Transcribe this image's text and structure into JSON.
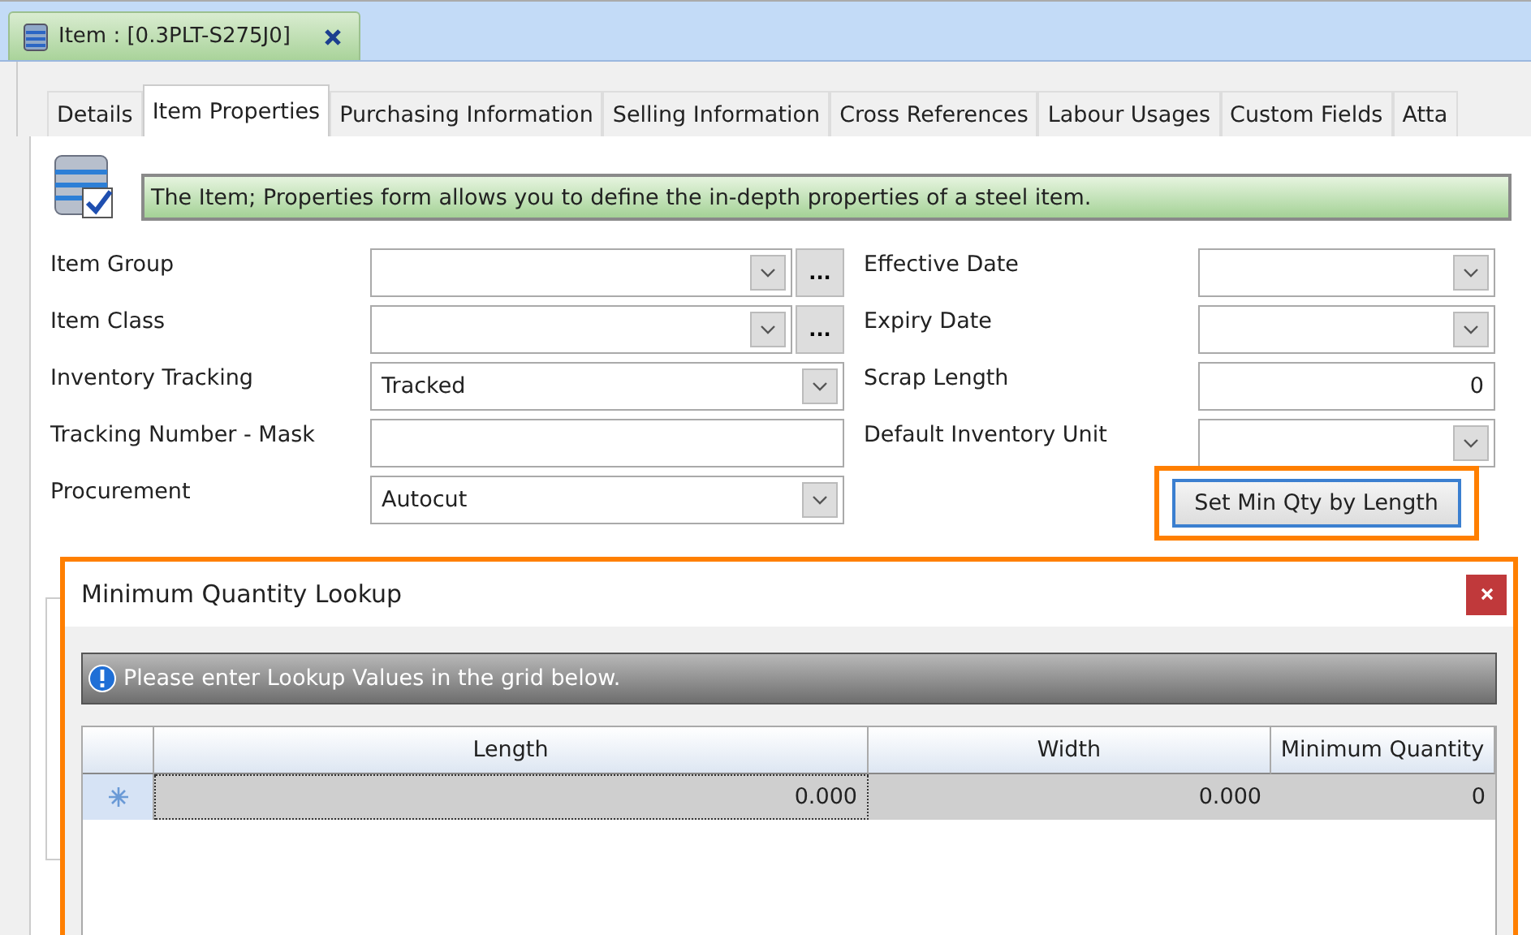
{
  "document_tab": {
    "title": "Item : [0.3PLT-S275J0]"
  },
  "tabs": [
    {
      "label": "Details",
      "selected": false
    },
    {
      "label": "Item Properties",
      "selected": true
    },
    {
      "label": "Purchasing Information",
      "selected": false
    },
    {
      "label": "Selling Information",
      "selected": false
    },
    {
      "label": "Cross References",
      "selected": false
    },
    {
      "label": "Labour Usages",
      "selected": false
    },
    {
      "label": "Custom Fields",
      "selected": false
    },
    {
      "label": "Atta",
      "selected": false
    }
  ],
  "banner": "The Item; Properties form allows you to define the in-depth properties of a steel item.",
  "left_fields": [
    {
      "label": "Item Group",
      "kind": "lookup",
      "button": "..."
    },
    {
      "label": "Item Class",
      "kind": "lookup",
      "button": "..."
    },
    {
      "label": "Inventory Tracking",
      "kind": "combo",
      "value": "Tracked"
    },
    {
      "label": "Tracking Number - Mask",
      "kind": "text"
    },
    {
      "label": "Procurement",
      "kind": "combo",
      "value": "Autocut"
    }
  ],
  "right_fields": [
    {
      "label": "Effective Date",
      "kind": "combo"
    },
    {
      "label": "Expiry Date",
      "kind": "combo"
    },
    {
      "label": "Scrap Length",
      "kind": "number",
      "value": "0"
    },
    {
      "label": "Default Inventory Unit",
      "kind": "combo"
    }
  ],
  "min_qty_button": {
    "label": "Set Min Qty by Length",
    "highlighted": true
  },
  "dialog": {
    "title": "Minimum Quantity Lookup",
    "highlighted": true,
    "info": "Please enter Lookup Values in the grid below.",
    "columns": [
      "Length",
      "Width",
      "Minimum Quantity"
    ],
    "rows": [
      {
        "new_row": true,
        "cells": [
          {
            "text": "0.000",
            "focused": true
          },
          {
            "text": "0.000",
            "focused": false
          },
          {
            "text": "0",
            "focused": false
          }
        ]
      }
    ]
  }
}
